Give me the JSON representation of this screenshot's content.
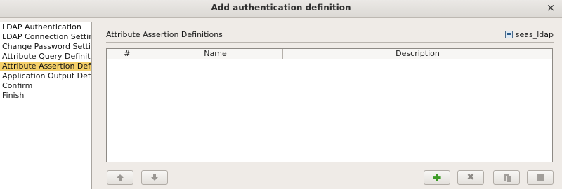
{
  "window": {
    "title": "Add authentication definition",
    "close_glyph": "×"
  },
  "steps": [
    {
      "label": "LDAP Authentication",
      "selected": false
    },
    {
      "label": "LDAP Connection Settings",
      "selected": false
    },
    {
      "label": "Change Password Settings",
      "selected": false
    },
    {
      "label": "Attribute Query Definitions",
      "selected": false
    },
    {
      "label": "Attribute Assertion Definitions",
      "selected": true
    },
    {
      "label": "Application Output Definitions",
      "selected": false
    },
    {
      "label": "Confirm",
      "selected": false
    },
    {
      "label": "Finish",
      "selected": false
    }
  ],
  "panel": {
    "title": "Attribute Assertion Definitions",
    "context_label": "seas_ldap",
    "context_icon": "document-list-icon"
  },
  "table": {
    "columns": [
      "#",
      "Name",
      "Description"
    ],
    "rows": []
  },
  "buttons": {
    "up": {
      "icon": "arrow-up-icon",
      "enabled": false
    },
    "down": {
      "icon": "arrow-down-icon",
      "enabled": false
    },
    "add": {
      "icon": "plus-icon",
      "glyph": "✚",
      "enabled": true
    },
    "delete": {
      "icon": "x-icon",
      "glyph": "✖",
      "enabled": false
    },
    "copy": {
      "icon": "copy-icon",
      "enabled": false
    },
    "edit": {
      "icon": "edit-icon",
      "enabled": false
    }
  },
  "colors": {
    "selected_step": "#f5d06a",
    "add_icon": "#3e9c28"
  }
}
